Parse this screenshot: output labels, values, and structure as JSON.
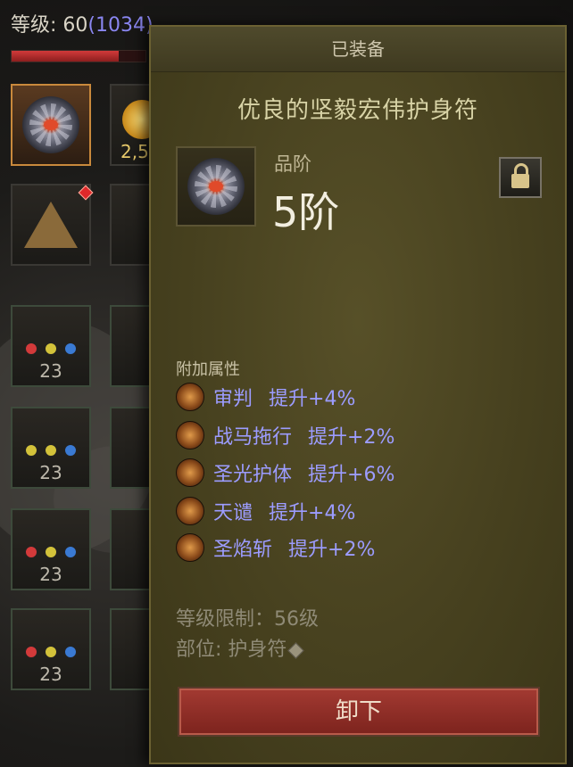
{
  "character": {
    "level_label": "等级: 60",
    "paragon": "(1034)",
    "hp_fraction": 0.8
  },
  "inventory": {
    "coin_count": "2,5",
    "gem_slot_levels": [
      "23",
      "23",
      "23",
      "23"
    ]
  },
  "tooltip": {
    "header": "已装备",
    "item_name": "优良的坚毅宏伟护身符",
    "icon": "amulet-icon",
    "tier_label": "品阶",
    "tier_value": "5阶",
    "lock_icon": "lock-icon",
    "affix_section_label": "附加属性",
    "affixes": [
      {
        "skill": "审判",
        "bonus": "提升+4%",
        "icon": "judgment-skill-icon"
      },
      {
        "skill": "战马拖行",
        "bonus": "提升+2%",
        "icon": "charger-skill-icon"
      },
      {
        "skill": "圣光护体",
        "bonus": "提升+6%",
        "icon": "holy-shield-skill-icon"
      },
      {
        "skill": "天谴",
        "bonus": "提升+4%",
        "icon": "wrath-skill-icon"
      },
      {
        "skill": "圣焰斩",
        "bonus": "提升+2%",
        "icon": "holy-flame-skill-icon"
      }
    ],
    "level_requirement": "等级限制：56级",
    "slot": "部位: 护身符",
    "unequip_button": "卸下"
  },
  "colors": {
    "panel_bg": "#47411f",
    "affix_text": "#9c9cff",
    "button_red": "#a33a32"
  }
}
